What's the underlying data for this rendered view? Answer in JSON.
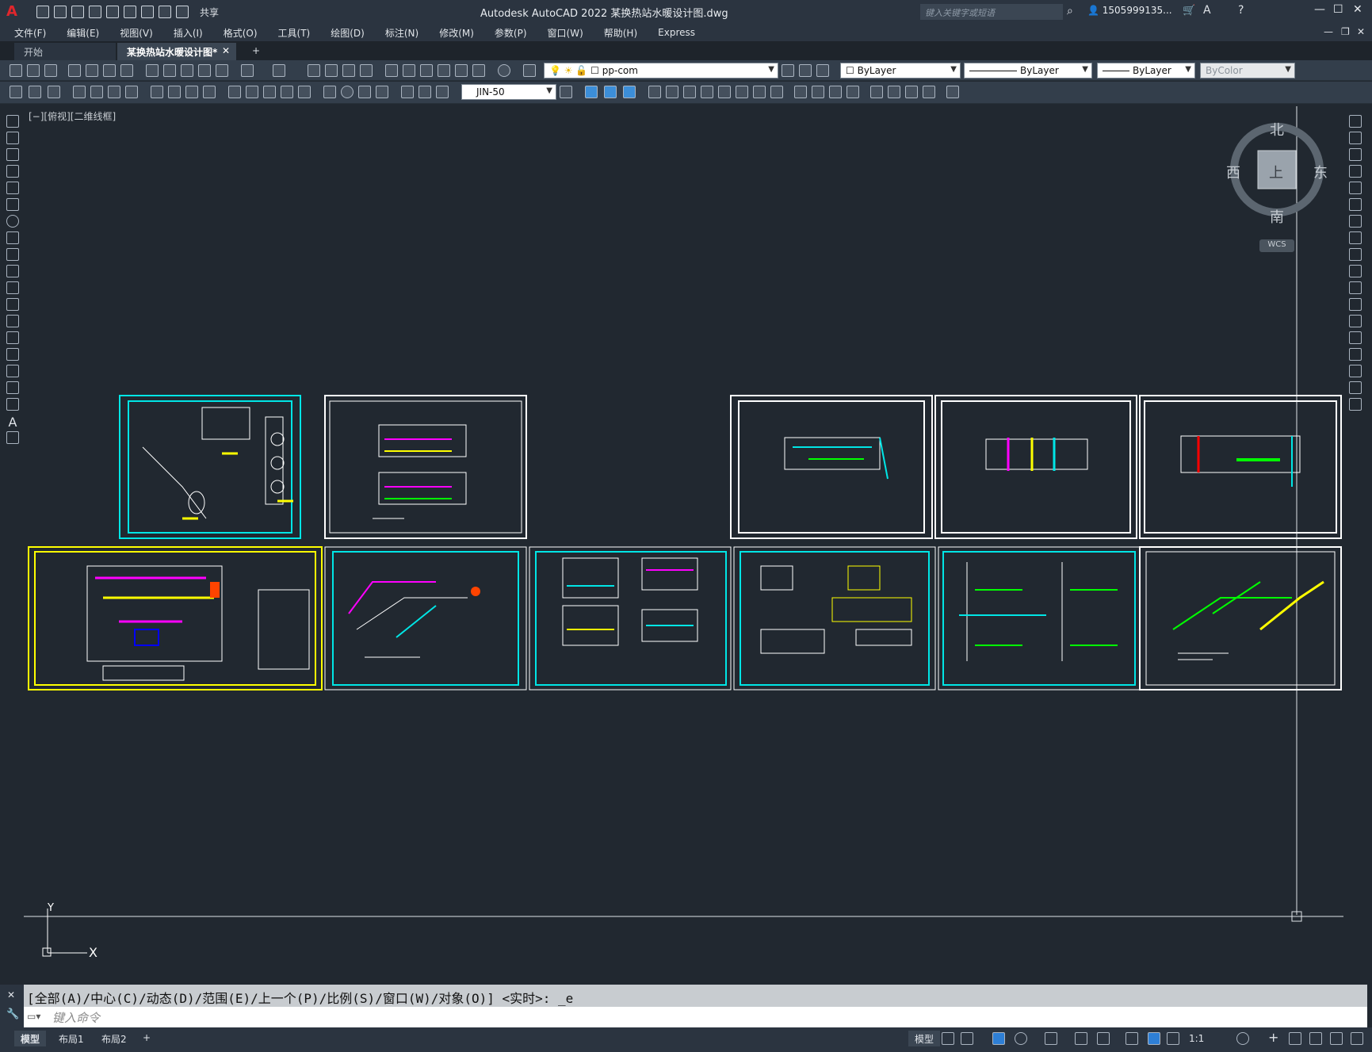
{
  "titlebar": {
    "app_title": "Autodesk AutoCAD 2022    某换热站水暖设计图.dwg",
    "share_label": "共享",
    "search_placeholder": "键入关键字或短语",
    "user": "1505999135...",
    "minimize": "—",
    "maximize": "☐",
    "close": "✕"
  },
  "menu": [
    "文件(F)",
    "编辑(E)",
    "视图(V)",
    "插入(I)",
    "格式(O)",
    "工具(T)",
    "绘图(D)",
    "标注(N)",
    "修改(M)",
    "参数(P)",
    "窗口(W)",
    "帮助(H)",
    "Express"
  ],
  "tabs": {
    "start": "开始",
    "drawing": "某换热站水暖设计图*",
    "close": "✕",
    "add": "+"
  },
  "toolbar": {
    "layer_combo": "pp-com",
    "color_combo": "ByLayer",
    "linetype_combo": "ByLayer",
    "lineweight_combo": "ByLayer",
    "plotstyle_combo": "ByColor",
    "dimstyle_combo": "JIN-50"
  },
  "viewport": {
    "view_label": "[−][俯视][二维线框]"
  },
  "viewcube": {
    "north": "北",
    "south": "南",
    "west": "西",
    "east": "东",
    "top": "上",
    "wcs": "WCS"
  },
  "ucs": {
    "x": "X",
    "y": "Y"
  },
  "command": {
    "history": "[全部(A)/中心(C)/动态(D)/范围(E)/上一个(P)/比例(S)/窗口(W)/对象(O)] <实时>: _e",
    "placeholder": "键入命令"
  },
  "status": {
    "layout_tabs": [
      "模型",
      "布局1",
      "布局2"
    ],
    "add_layout": "+",
    "model_label": "模型",
    "scale": "1:1"
  },
  "colors": {
    "frame_white": "#ffffff",
    "frame_cyan": "#00e6e6",
    "frame_yellow": "#ffff00",
    "canvas_bg": "#212830"
  }
}
